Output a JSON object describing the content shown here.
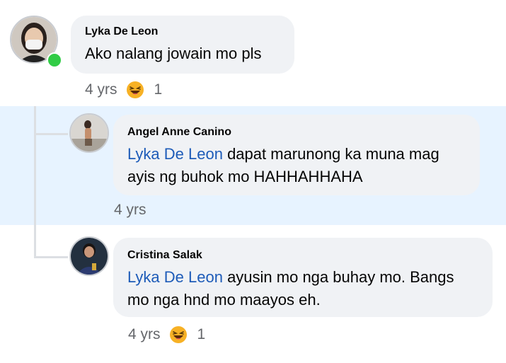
{
  "comments": [
    {
      "author": "Lyka De Leon",
      "text": "Ako nalang jowain mo pls",
      "time": "4 yrs",
      "reaction_count": "1",
      "reaction_icon": "laughing-emoji"
    }
  ],
  "replies": [
    {
      "author": "Angel Anne Canino",
      "mention": "Lyka De Leon",
      "text_line1": " dapat marunong ka muna mag",
      "text_line2": "ayis ng buhok mo HAHHAHHAHA",
      "time": "4 yrs"
    },
    {
      "author": "Cristina Salak",
      "mention": "Lyka De Leon",
      "text_line1": " ayusin mo nga buhay mo. Bangs",
      "text_line2": "mo nga hnd mo maayos eh.",
      "time": "4 yrs",
      "reaction_count": "1",
      "reaction_icon": "laughing-emoji"
    }
  ],
  "colors": {
    "highlight": "#e7f3ff",
    "bubble": "#f0f2f5",
    "mention": "#1d5bb8",
    "online": "#31cc46"
  }
}
